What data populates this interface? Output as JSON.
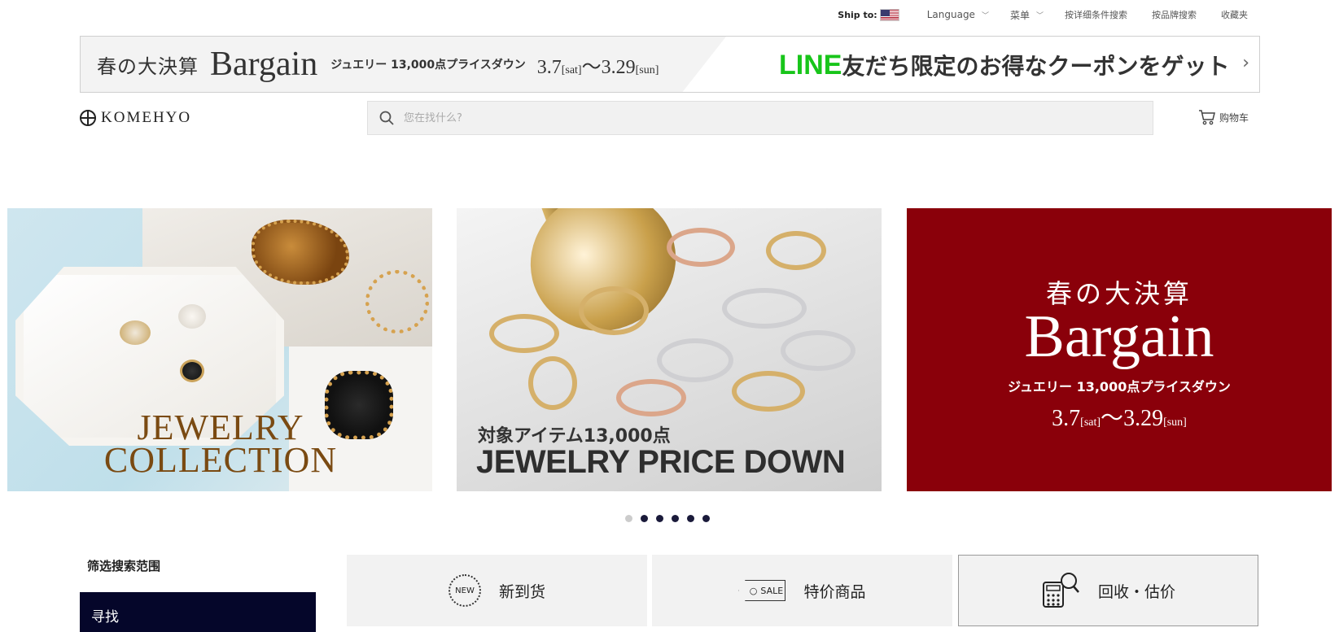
{
  "topbar": {
    "ship_to": "Ship to:",
    "language": "Language",
    "menu": "菜单",
    "detail_search": "按详细条件搜索",
    "brand_search": "按品牌搜索",
    "favorites": "收藏夹"
  },
  "promo": {
    "spring": "春の大決算",
    "bargain": "Bargain",
    "sub": "ジュエリー 13,000点プライスダウン",
    "date_start": "3.7",
    "sat": "[sat]",
    "tilde": "～",
    "date_end": "3.29",
    "sun": "[sun]",
    "line_word": "LINE",
    "line_rest": "友だち限定のお得なクーポンをゲット"
  },
  "header": {
    "logo": "KOMEHYO",
    "search_placeholder": "您在找什么?",
    "cart": "购物车"
  },
  "slides": {
    "s1_title_1": "JEWELRY",
    "s1_title_2": "COLLECTION",
    "s2_line1": "対象アイテム13,000点",
    "s2_line2": "JEWELRY PRICE DOWN",
    "s3_spring": "春の大決算",
    "s3_bargain": "Bargain",
    "s3_sub": "ジュエリー 13,000点プライスダウン",
    "s3_date_start": "3.7",
    "s3_sat": "[sat]",
    "s3_tilde": "～",
    "s3_date_end": "3.29",
    "s3_sun": "[sun]"
  },
  "carousel": {
    "dot_count": 6,
    "active_index": 0
  },
  "filter": {
    "title": "筛选搜索范围",
    "find": "寻找"
  },
  "tiles": {
    "new_icon": "NEW",
    "new_label": "新到货",
    "sale_icon": "SALE",
    "sale_label": "特价商品",
    "buyback_label": "回收・估价"
  },
  "colors": {
    "line_green": "#18c51a",
    "bargain_red": "#8a000a",
    "navy": "#05062a"
  }
}
